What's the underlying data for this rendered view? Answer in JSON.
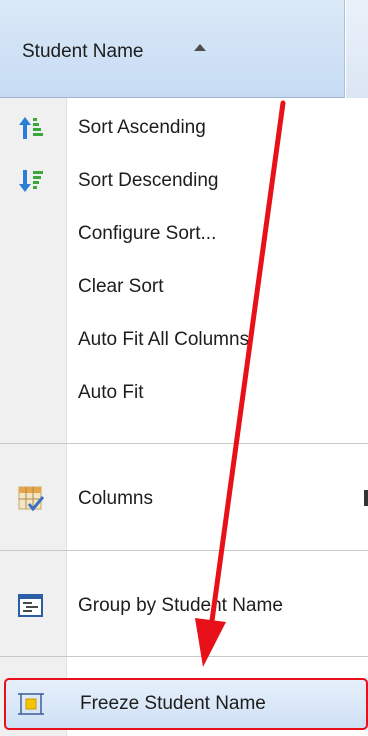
{
  "header": {
    "column_title": "Student Name",
    "sort_direction": "ascending"
  },
  "menu": {
    "items": [
      {
        "label": "Sort Ascending",
        "icon": "sort-ascending-icon"
      },
      {
        "label": "Sort Descending",
        "icon": "sort-descending-icon"
      },
      {
        "label": "Configure Sort..."
      },
      {
        "label": "Clear Sort"
      },
      {
        "label": "Auto Fit All Columns"
      },
      {
        "label": "Auto Fit"
      },
      {
        "label": "Columns",
        "icon": "columns-icon",
        "has_submenu": true
      },
      {
        "label": "Group by Student Name",
        "icon": "group-by-icon"
      },
      {
        "label": "Freeze Student Name",
        "icon": "freeze-column-icon",
        "highlighted": true
      }
    ]
  },
  "annotation": {
    "arrow_color": "#e8111a",
    "highlight_color": "#e8111a"
  }
}
